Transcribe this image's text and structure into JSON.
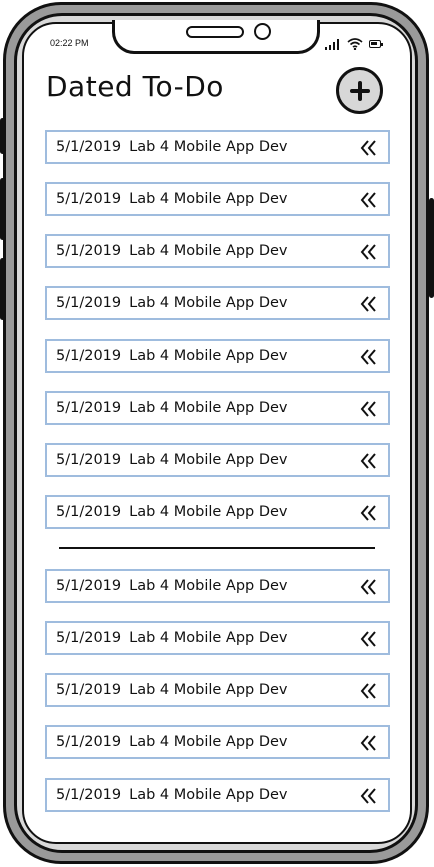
{
  "status_bar": {
    "time": "02:22 PM"
  },
  "header": {
    "title": "Dated To-Do",
    "add_icon": "plus-icon"
  },
  "list_top": [
    {
      "date": "5/1/2019",
      "title": "Lab 4 Mobile App Dev"
    },
    {
      "date": "5/1/2019",
      "title": "Lab 4 Mobile App Dev"
    },
    {
      "date": "5/1/2019",
      "title": "Lab 4 Mobile App Dev"
    },
    {
      "date": "5/1/2019",
      "title": "Lab 4 Mobile App Dev"
    },
    {
      "date": "5/1/2019",
      "title": "Lab 4 Mobile App Dev"
    },
    {
      "date": "5/1/2019",
      "title": "Lab 4 Mobile App Dev"
    },
    {
      "date": "5/1/2019",
      "title": "Lab 4 Mobile App Dev"
    },
    {
      "date": "5/1/2019",
      "title": "Lab 4 Mobile App Dev"
    }
  ],
  "list_bottom": [
    {
      "date": "5/1/2019",
      "title": "Lab 4 Mobile App Dev"
    },
    {
      "date": "5/1/2019",
      "title": "Lab 4 Mobile App Dev"
    },
    {
      "date": "5/1/2019",
      "title": "Lab 4 Mobile App Dev"
    },
    {
      "date": "5/1/2019",
      "title": "Lab 4 Mobile App Dev"
    },
    {
      "date": "5/1/2019",
      "title": "Lab 4 Mobile App Dev"
    }
  ],
  "item_icon": "double-chevron-left-icon",
  "colors": {
    "item_border": "#9fbcde",
    "ink": "#111111",
    "frame": "#9a9a9a"
  }
}
